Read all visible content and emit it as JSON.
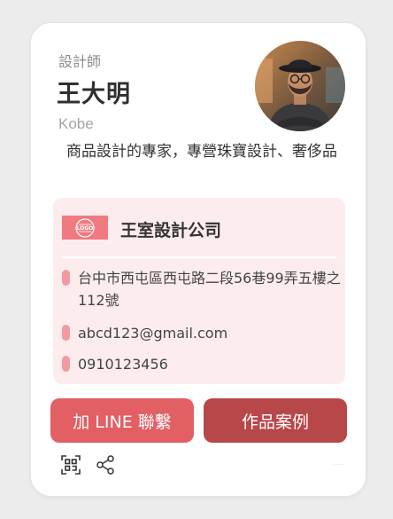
{
  "profile": {
    "job_title": "設計師",
    "name": "王大明",
    "english_name": "Kobe",
    "bio": "商品設計的專家，專營珠寶設計、奢侈品"
  },
  "company": {
    "logo_text": "LOGO",
    "name": "王室設計公司",
    "address": "台中市西屯區西屯路二段56巷99弄五樓之112號",
    "email": "abcd123@gmail.com",
    "phone": "0910123456"
  },
  "actions": {
    "line_label": "加 LINE 聯繫",
    "works_label": "作品案例"
  },
  "footer": {
    "watermark": "········"
  },
  "icons": {
    "qr": "qr-code-icon",
    "share": "share-icon"
  },
  "colors": {
    "accent": "#e25f64",
    "accent_dark": "#b8474a",
    "company_bg": "#fdecee",
    "bullet": "#f29aa0"
  }
}
